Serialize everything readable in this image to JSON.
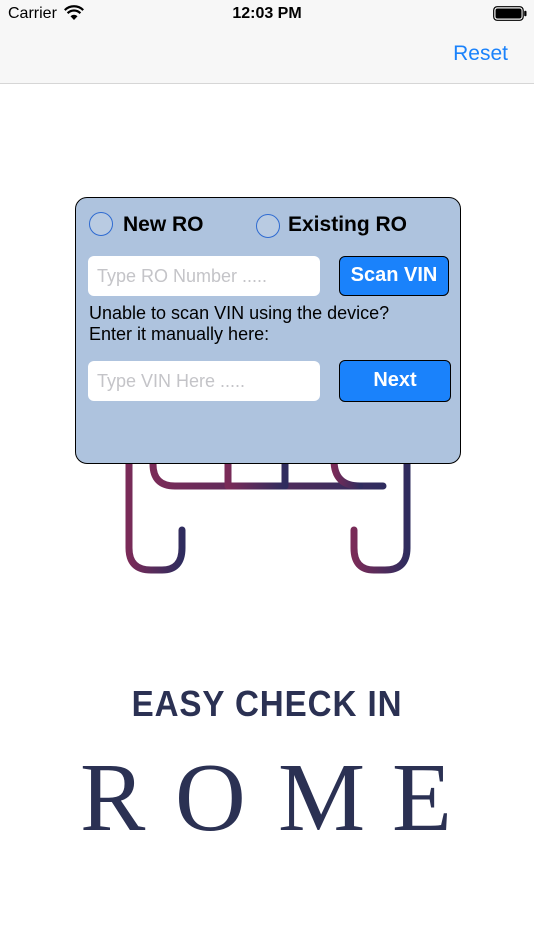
{
  "status_bar": {
    "carrier": "Carrier",
    "time": "12:03 PM",
    "icons": [
      "wifi-icon",
      "battery-icon"
    ]
  },
  "nav_bar": {
    "reset_label": "Reset",
    "accent_color": "#1a82fb"
  },
  "modal": {
    "radio_options": [
      {
        "label": "New RO",
        "selected": false
      },
      {
        "label": "Existing RO",
        "selected": false
      }
    ],
    "ro_number_field": {
      "value": "",
      "placeholder": "Type RO Number ....."
    },
    "scan_vin_label": "Scan VIN",
    "help_line_1": "Unable to scan VIN using the device?",
    "help_line_2": "Enter it manually here:",
    "vin_field": {
      "value": "",
      "placeholder": "Type VIN Here ....."
    },
    "next_label": "Next",
    "background_color": "#aec3de"
  },
  "brand": {
    "title": "EASY CHECK IN",
    "name_letters": [
      "R",
      "O",
      "M",
      "E"
    ],
    "text_color": "#2b3153"
  }
}
